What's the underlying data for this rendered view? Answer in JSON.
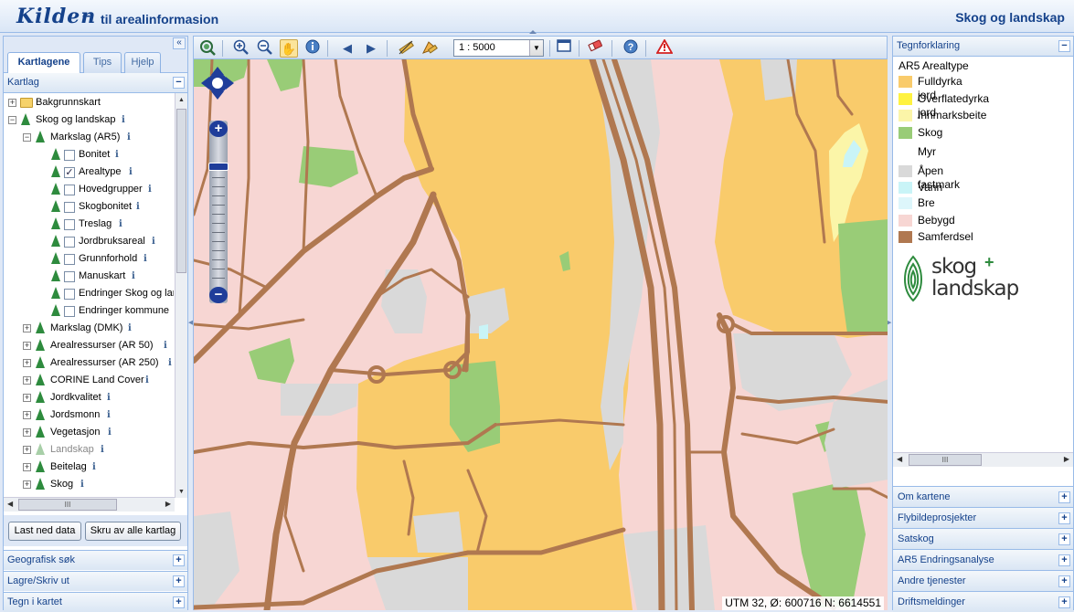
{
  "header": {
    "logo": "Kilden",
    "separator": "–",
    "subtitle": "til arealinformasion",
    "brand": "Skog og landskap"
  },
  "left": {
    "collapse_icon": "«",
    "tabs": [
      "Kartlagene",
      "Tips",
      "Hjelp"
    ],
    "panel_title": "Kartlag",
    "tree": [
      {
        "label": "Bakgrunnskart",
        "icon": "folder"
      },
      {
        "label": "Skog og landskap",
        "icon": "tree",
        "info": "i"
      },
      {
        "label": "Markslag (AR5)",
        "icon": "tree",
        "info": "i"
      },
      {
        "label": "Bonitet",
        "checked": false,
        "info": "i"
      },
      {
        "label": "Arealtype",
        "checked": true,
        "info": "i"
      },
      {
        "label": "Hovedgrupper",
        "checked": false,
        "info": "i"
      },
      {
        "label": "Skogbonitet",
        "checked": false,
        "info": "i"
      },
      {
        "label": "Treslag",
        "checked": false,
        "info": "i"
      },
      {
        "label": "Jordbruksareal",
        "checked": false,
        "info": "i"
      },
      {
        "label": "Grunnforhold",
        "checked": false,
        "info": "i"
      },
      {
        "label": "Manuskart",
        "checked": false,
        "info": "i"
      },
      {
        "label": "Endringer Skog og lar",
        "checked": false
      },
      {
        "label": "Endringer kommune",
        "checked": false
      },
      {
        "label": "Markslag (DMK)",
        "info": "i"
      },
      {
        "label": "Arealressurser (AR 50)",
        "info": "i"
      },
      {
        "label": "Arealressurser (AR 250)",
        "info": "i"
      },
      {
        "label": "CORINE Land Cover",
        "info": "i"
      },
      {
        "label": "Jordkvalitet",
        "info": "i"
      },
      {
        "label": "Jordsmonn",
        "info": "i"
      },
      {
        "label": "Vegetasjon",
        "info": "i"
      },
      {
        "label": "Landskap",
        "info": "i",
        "dimmed": true
      },
      {
        "label": "Beitelag",
        "info": "i"
      },
      {
        "label": "Skog",
        "info": "i"
      }
    ],
    "hscroll_grip": "III",
    "buttons": {
      "load": "Last ned data",
      "off": "Skru av alle kartlag"
    },
    "sections": [
      "Geografisk søk",
      "Lagre/Skriv ut",
      "Tegn i kartet"
    ]
  },
  "toolbar": {
    "scale": "1 : 5000",
    "icons": [
      "zoom-extent-icon",
      "zoom-in-icon",
      "zoom-out-icon",
      "pan-hand-icon",
      "identify-icon",
      "back-arrow-icon",
      "forward-arrow-icon",
      "measure-line-icon",
      "measure-area-icon",
      "fullscreen-icon",
      "eraser-icon",
      "help-icon",
      "warning-icon"
    ]
  },
  "map": {
    "coords": "UTM 32, Ø: 600716 N: 6614551",
    "colors": {
      "fulldyrka": "#f9cb6b",
      "bebygd": "#f7d6d3",
      "skog": "#99cc77",
      "aapen": "#d9d9d9",
      "samferdsel": "#b07850",
      "innmark": "#fbf5a8",
      "vann": "#c9f4f7"
    }
  },
  "legend": {
    "header": "Tegnforklaring",
    "title": "AR5 Arealtype",
    "items": [
      {
        "label": "Fulldyrka jord",
        "color": "#f9cb6b"
      },
      {
        "label": "Overflatedyrka jord",
        "color": "#fff240"
      },
      {
        "label": "Innmarksbeite",
        "color": "#fbf5a8"
      },
      {
        "label": "Skog",
        "color": "#99cc77"
      },
      {
        "label": "Myr",
        "color": "#ffffff"
      },
      {
        "label": "Åpen fastmark",
        "color": "#d9d9d9"
      },
      {
        "label": "Vann",
        "color": "#c9f4f7"
      },
      {
        "label": "Bre",
        "color": "#ddf6fb"
      },
      {
        "label": "Bebygd",
        "color": "#f7d6d3"
      },
      {
        "label": "Samferdsel",
        "color": "#b07850"
      }
    ],
    "logo_text1": "skog",
    "logo_text2": "landskap",
    "logo_plus": "+",
    "scroll_grip": "III"
  },
  "right_sections": [
    "Om kartene",
    "Flybildeprosjekter",
    "Satskog",
    "AR5 Endringsanalyse",
    "Andre tjenester",
    "Driftsmeldinger"
  ]
}
